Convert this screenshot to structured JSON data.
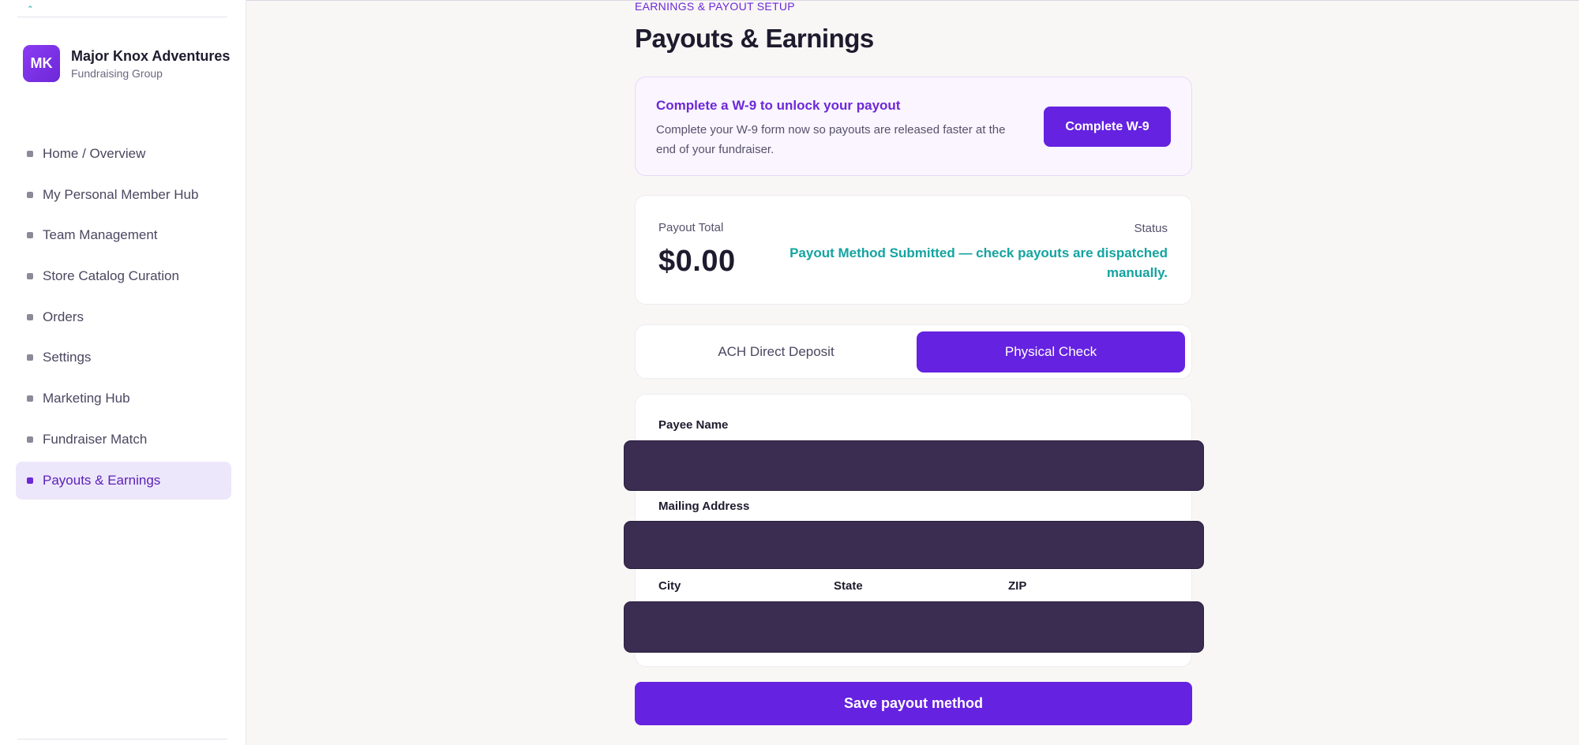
{
  "sidebar": {
    "logo_glyph": "ꞈ",
    "org": {
      "initials": "MK",
      "name": "Major Knox Adventures",
      "subtitle": "Fundraising Group"
    },
    "items": [
      {
        "label": "Home / Overview",
        "active": false
      },
      {
        "label": "My Personal Member Hub",
        "active": false
      },
      {
        "label": "Team Management",
        "active": false
      },
      {
        "label": "Store Catalog Curation",
        "active": false
      },
      {
        "label": "Orders",
        "active": false
      },
      {
        "label": "Settings",
        "active": false
      },
      {
        "label": "Marketing Hub",
        "active": false
      },
      {
        "label": "Fundraiser Match",
        "active": false
      },
      {
        "label": "Payouts & Earnings",
        "active": true
      }
    ]
  },
  "header": {
    "eyebrow": "EARNINGS & PAYOUT SETUP",
    "title": "Payouts & Earnings"
  },
  "w9_banner": {
    "title": "Complete a W-9 to unlock your payout",
    "description": "Complete your W-9 form now so payouts are released faster at the end of your fundraiser.",
    "button_label": "Complete W-9"
  },
  "payout": {
    "total_label": "Payout Total",
    "total_value": "$0.00",
    "status_label": "Status",
    "status_value": "Payout Method Submitted — check payouts are dispatched manually."
  },
  "method_tabs": {
    "ach_label": "ACH Direct Deposit",
    "check_label": "Physical Check",
    "selected": "Physical Check"
  },
  "form": {
    "payee_name_label": "Payee Name",
    "payee_name_value": "",
    "mailing_address_label": "Mailing Address",
    "mailing_address_value": "",
    "city_label": "City",
    "state_label": "State",
    "zip_label": "ZIP",
    "city_state_zip_value": ""
  },
  "save_button_label": "Save payout method",
  "colors": {
    "accent": "#6522e0",
    "status_teal": "#14a3a0",
    "input_redacted": "#3b2c52"
  }
}
